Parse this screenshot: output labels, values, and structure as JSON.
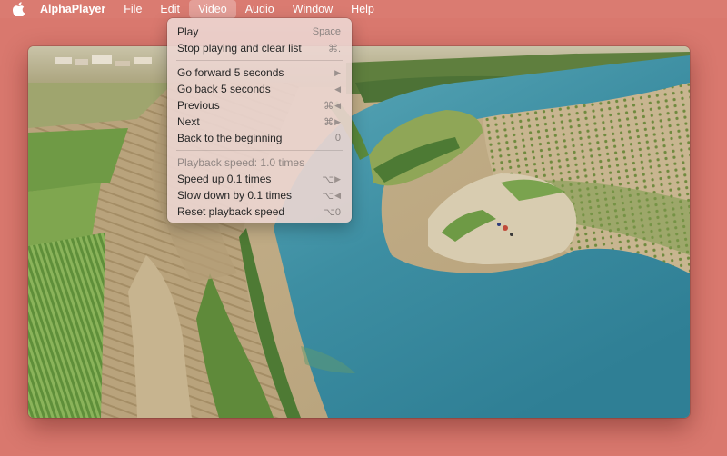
{
  "menubar": {
    "items": [
      {
        "label": "AlphaPlayer"
      },
      {
        "label": "File"
      },
      {
        "label": "Edit"
      },
      {
        "label": "Video"
      },
      {
        "label": "Audio"
      },
      {
        "label": "Window"
      },
      {
        "label": "Help"
      }
    ],
    "active_menu": "Video"
  },
  "video_menu": {
    "play": {
      "label": "Play",
      "shortcut": "Space"
    },
    "stop": {
      "label": "Stop playing and clear list",
      "shortcut": "⌘."
    },
    "forward": {
      "label": "Go forward 5 seconds",
      "shortcut_icon": "right-arrow-icon"
    },
    "back": {
      "label": "Go back 5 seconds",
      "shortcut_icon": "left-arrow-icon"
    },
    "previous": {
      "label": "Previous",
      "shortcut": "⌘",
      "shortcut_icon": "left-arrow-icon"
    },
    "next": {
      "label": "Next",
      "shortcut": "⌘",
      "shortcut_icon": "right-arrow-icon"
    },
    "beginning": {
      "label": "Back to the beginning",
      "shortcut": "0"
    },
    "speed_status": {
      "label": "Playback speed: 1.0 times"
    },
    "speed_up": {
      "label": "Speed up 0.1 times",
      "shortcut": "⌥",
      "shortcut_icon": "right-arrow-icon"
    },
    "slow_down": {
      "label": "Slow down by 0.1 times",
      "shortcut": "⌥",
      "shortcut_icon": "left-arrow-icon"
    },
    "reset_speed": {
      "label": "Reset playback speed",
      "shortcut": "⌥0"
    }
  },
  "colors": {
    "desktop_background": "#d9786e",
    "menu_background": "#ecd6d2",
    "water": "#3f8fa3"
  }
}
